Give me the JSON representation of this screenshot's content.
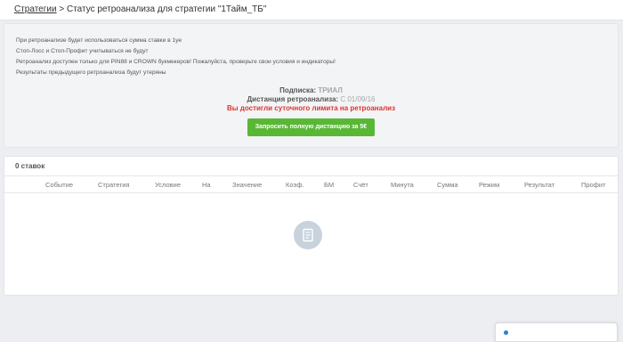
{
  "breadcrumb": {
    "link": "Стратегии",
    "separator": " > ",
    "title": "Статус ретроанализа для стратегии \"1Тайм_ТБ\""
  },
  "info": {
    "lines": [
      "При ретроанализе будет использоваться сумма ставки в 1уе",
      "Стоп-Лосс и Стоп-Профит учитываться не будут",
      "Ретроанализ доступен только для PIN88 и CROWN букмекеров! Пожалуйста, проверьте свои условия и индикаторы!",
      "Результаты предыдущего ретроанализа будут утеряны"
    ]
  },
  "subscription": {
    "label": "Подписка:",
    "value": "ТРИАЛ",
    "distance_label": "Дистанция ретроанализа:",
    "distance_value": "С 01/09/16",
    "limit_message": "Вы достигли суточного лимита на ретроанализ"
  },
  "request_button": {
    "label": "Запросить полную дистанцию за 5€"
  },
  "bets": {
    "title": "0 ставок",
    "columns": [
      "Событие",
      "Стратегия",
      "Условие",
      "На",
      "Значение",
      "Коэф.",
      "БМ",
      "Счёт",
      "Минута",
      "Сумма",
      "Режим",
      "Результат",
      "Профит"
    ]
  },
  "colors": {
    "accent_green": "#59b736",
    "limit_red": "#d9352f",
    "page_bg": "#eceef1"
  },
  "icons": {
    "empty_state": "document-icon",
    "chat": "chat-icon"
  }
}
